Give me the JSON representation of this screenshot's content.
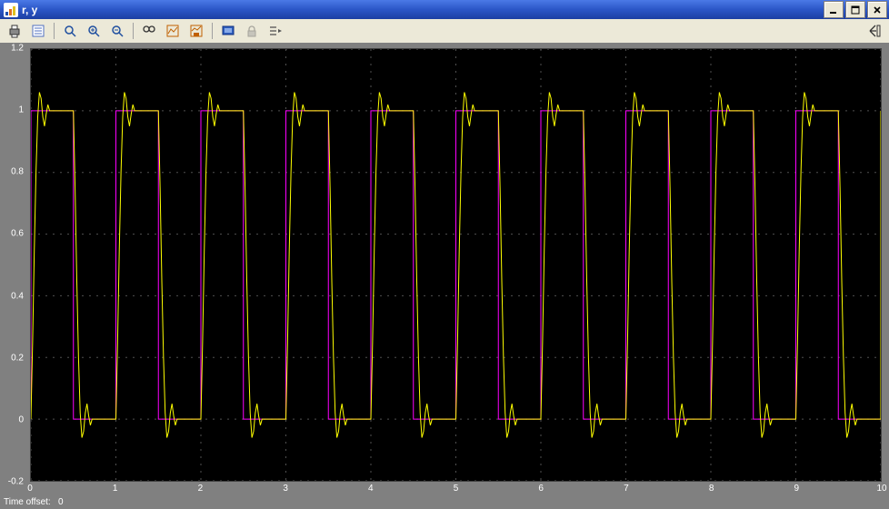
{
  "window": {
    "title": "r, y"
  },
  "toolbar": {
    "print_tip": "Print",
    "params_tip": "Parameters",
    "zoomin_tip": "Zoom In",
    "zoomxy_tip": "Zoom X-Y",
    "zoomout_tip": "Zoom Out",
    "find_tip": "Find",
    "autoscale_tip": "Autoscale",
    "saveaxes_tip": "Save axes",
    "float_tip": "Floating scope",
    "lock_tip": "Lock axes",
    "select_tip": "Signal selection"
  },
  "status": {
    "time_offset_label": "Time offset:",
    "time_offset_value": "0"
  },
  "chart_data": {
    "type": "line",
    "xlabel": "",
    "ylabel": "",
    "xlim": [
      0,
      10
    ],
    "ylim": [
      -0.2,
      1.2
    ],
    "xticks": [
      0,
      1,
      2,
      3,
      4,
      5,
      6,
      7,
      8,
      9,
      10
    ],
    "yticks": [
      -0.2,
      0,
      0.2,
      0.4,
      0.6,
      0.8,
      1,
      1.2
    ],
    "series": [
      {
        "name": "r",
        "color": "#FF00FF",
        "x": [
          0,
          0.0,
          0.5,
          0.5,
          1.0,
          1.0,
          1.5,
          1.5,
          2.0,
          2.0,
          2.5,
          2.5,
          3.0,
          3.0,
          3.5,
          3.5,
          4.0,
          4.0,
          4.5,
          4.5,
          5.0,
          5.0,
          5.5,
          5.5,
          6.0,
          6.0,
          6.5,
          6.5,
          7.0,
          7.0,
          7.5,
          7.5,
          8.0,
          8.0,
          8.5,
          8.5,
          9.0,
          9.0,
          9.5,
          9.5,
          10.0,
          10.0
        ],
        "y": [
          0,
          1,
          1,
          0,
          0,
          1,
          1,
          0,
          0,
          1,
          1,
          0,
          0,
          1,
          1,
          0,
          0,
          1,
          1,
          0,
          0,
          1,
          1,
          0,
          0,
          1,
          1,
          0,
          0,
          1,
          1,
          0,
          0,
          1,
          1,
          0,
          0,
          1,
          1,
          0,
          0,
          1
        ]
      },
      {
        "name": "y",
        "color": "#FFFF00",
        "x": [
          0.0,
          0.02,
          0.04,
          0.06,
          0.08,
          0.1,
          0.12,
          0.14,
          0.16,
          0.18,
          0.2,
          0.22,
          0.24,
          0.3,
          0.4,
          0.5,
          0.52,
          0.54,
          0.56,
          0.58,
          0.6,
          0.62,
          0.64,
          0.66,
          0.68,
          0.7,
          0.72,
          0.74,
          0.8,
          0.9,
          1.0
        ],
        "y": [
          0.0,
          0.25,
          0.55,
          0.8,
          0.98,
          1.06,
          1.04,
          0.98,
          0.95,
          0.99,
          1.02,
          1.0,
          1.0,
          1.0,
          1.0,
          1.0,
          0.75,
          0.45,
          0.2,
          0.02,
          -0.06,
          -0.04,
          0.02,
          0.05,
          0.01,
          -0.02,
          0.0,
          0.0,
          0.0,
          0.0,
          0.0
        ]
      }
    ],
    "period": 1.0,
    "repeats": 10
  }
}
